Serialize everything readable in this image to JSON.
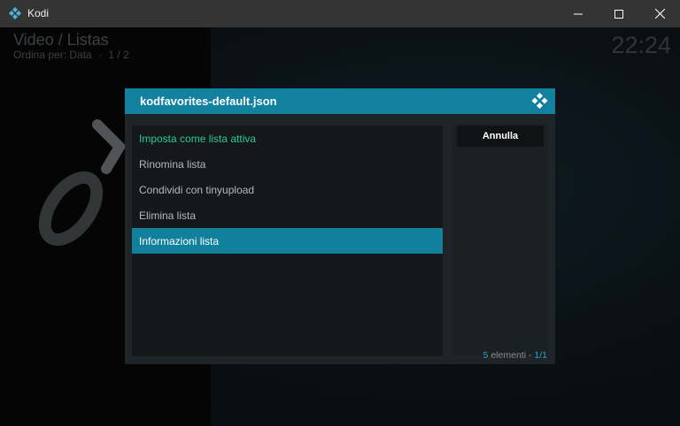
{
  "window": {
    "title": "Kodi",
    "icon": "kodi-logo-icon",
    "controls": [
      "minimize-icon",
      "maximize-icon",
      "close-icon"
    ]
  },
  "header": {
    "title": "Video / Listas",
    "sort_label": "Ordina per: Data",
    "page": "1 / 2",
    "clock": "22:24"
  },
  "dialog": {
    "title": "kodfavorites-default.json",
    "logo_icon": "kodi-logo-icon",
    "items": [
      {
        "label": "Imposta come lista attiva",
        "state": "active"
      },
      {
        "label": "Rinomina lista",
        "state": "normal"
      },
      {
        "label": "Condividi con tinyupload",
        "state": "normal"
      },
      {
        "label": "Elimina lista",
        "state": "normal"
      },
      {
        "label": "Informazioni lista",
        "state": "selected"
      }
    ],
    "cancel_label": "Annulla",
    "footer": {
      "count": "5",
      "count_label": "elementi",
      "sep": "-",
      "page": "1/1"
    }
  },
  "colors": {
    "accent": "#12809f",
    "active_text": "#28c89b",
    "dialog_bg": "#1e2427"
  }
}
